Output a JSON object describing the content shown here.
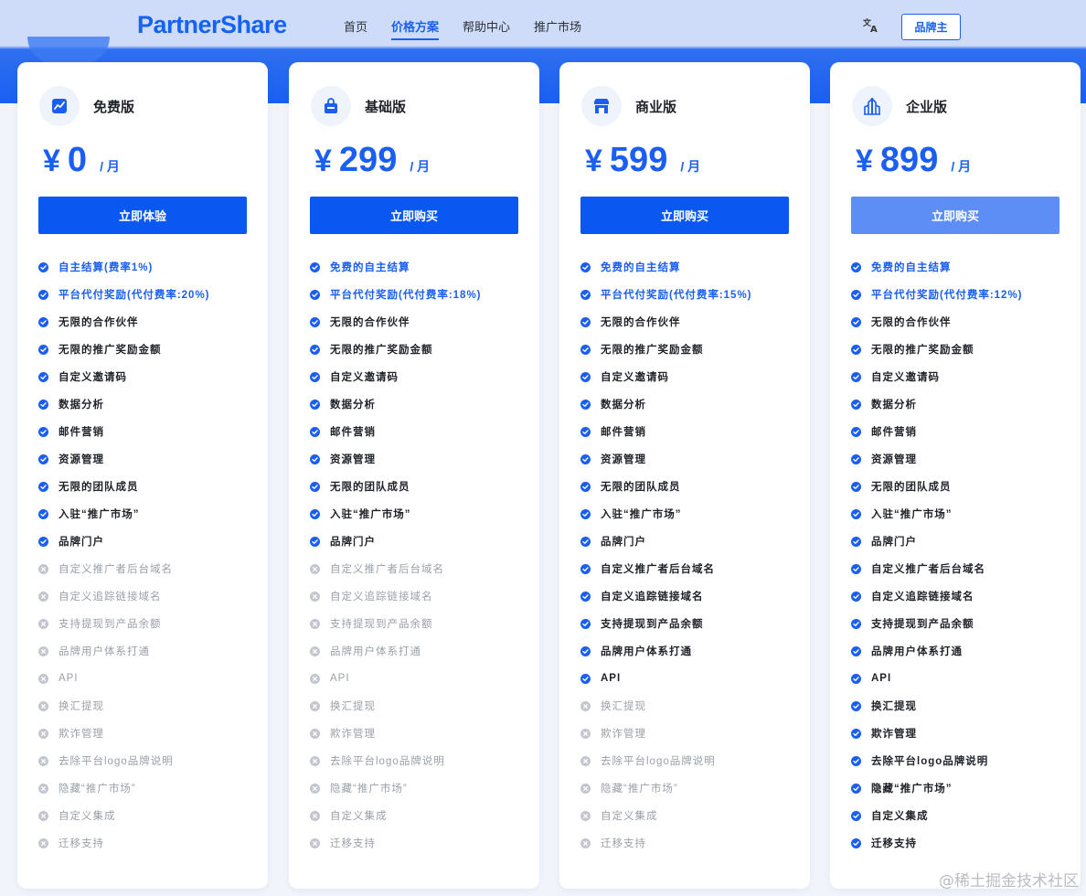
{
  "header": {
    "logo": "PartnerShare",
    "nav": [
      "首页",
      "价格方案",
      "帮助中心",
      "推广市场"
    ],
    "active_nav": "价格方案",
    "lang_icon": "translate-icon",
    "brand_button": "品牌主"
  },
  "colors": {
    "accent": "#1a5ff2",
    "check": "#1a5ff2",
    "cross": "#c3c7cd",
    "disabled_text": "#9aa0a8",
    "header_bg": "#cfdcf9"
  },
  "plans": [
    {
      "name": "免费版",
      "icon": "trend-icon",
      "currency": "¥",
      "price": "0",
      "unit": "/ 月",
      "cta": "立即体验",
      "features": [
        {
          "text": "自主结算(费率1%)",
          "state": "hl"
        },
        {
          "text": "平台代付奖励(代付费率:20%)",
          "state": "hl"
        },
        {
          "text": "无限的合作伙伴",
          "state": "on"
        },
        {
          "text": "无限的推广奖励金额",
          "state": "on"
        },
        {
          "text": "自定义邀请码",
          "state": "on"
        },
        {
          "text": "数据分析",
          "state": "on"
        },
        {
          "text": "邮件营销",
          "state": "on"
        },
        {
          "text": "资源管理",
          "state": "on"
        },
        {
          "text": "无限的团队成员",
          "state": "on"
        },
        {
          "text": "入驻“推广市场”",
          "state": "on"
        },
        {
          "text": "品牌门户",
          "state": "on"
        },
        {
          "text": "自定义推广者后台域名",
          "state": "off"
        },
        {
          "text": "自定义追踪链接域名",
          "state": "off"
        },
        {
          "text": "支持提现到产品余额",
          "state": "off"
        },
        {
          "text": "品牌用户体系打通",
          "state": "off"
        },
        {
          "text": "API",
          "state": "off"
        },
        {
          "text": "换汇提现",
          "state": "off"
        },
        {
          "text": "欺诈管理",
          "state": "off"
        },
        {
          "text": "去除平台logo品牌说明",
          "state": "off"
        },
        {
          "text": "隐藏“推广市场”",
          "state": "off"
        },
        {
          "text": "自定义集成",
          "state": "off"
        },
        {
          "text": "迁移支持",
          "state": "off"
        }
      ]
    },
    {
      "name": "基础版",
      "icon": "shopping-bag-icon",
      "currency": "¥",
      "price": "299",
      "unit": "/ 月",
      "cta": "立即购买",
      "features": [
        {
          "text": "免费的自主结算",
          "state": "hl"
        },
        {
          "text": "平台代付奖励(代付费率:18%)",
          "state": "hl"
        },
        {
          "text": "无限的合作伙伴",
          "state": "on"
        },
        {
          "text": "无限的推广奖励金额",
          "state": "on"
        },
        {
          "text": "自定义邀请码",
          "state": "on"
        },
        {
          "text": "数据分析",
          "state": "on"
        },
        {
          "text": "邮件营销",
          "state": "on"
        },
        {
          "text": "资源管理",
          "state": "on"
        },
        {
          "text": "无限的团队成员",
          "state": "on"
        },
        {
          "text": "入驻“推广市场”",
          "state": "on"
        },
        {
          "text": "品牌门户",
          "state": "on"
        },
        {
          "text": "自定义推广者后台域名",
          "state": "off"
        },
        {
          "text": "自定义追踪链接域名",
          "state": "off"
        },
        {
          "text": "支持提现到产品余额",
          "state": "off"
        },
        {
          "text": "品牌用户体系打通",
          "state": "off"
        },
        {
          "text": "API",
          "state": "off"
        },
        {
          "text": "换汇提现",
          "state": "off"
        },
        {
          "text": "欺诈管理",
          "state": "off"
        },
        {
          "text": "去除平台logo品牌说明",
          "state": "off"
        },
        {
          "text": "隐藏“推广市场”",
          "state": "off"
        },
        {
          "text": "自定义集成",
          "state": "off"
        },
        {
          "text": "迁移支持",
          "state": "off"
        }
      ]
    },
    {
      "name": "商业版",
      "icon": "storefront-icon",
      "currency": "¥",
      "price": "599",
      "unit": "/ 月",
      "cta": "立即购买",
      "features": [
        {
          "text": "免费的自主结算",
          "state": "hl"
        },
        {
          "text": "平台代付奖励(代付费率:15%)",
          "state": "hl"
        },
        {
          "text": "无限的合作伙伴",
          "state": "on"
        },
        {
          "text": "无限的推广奖励金额",
          "state": "on"
        },
        {
          "text": "自定义邀请码",
          "state": "on"
        },
        {
          "text": "数据分析",
          "state": "on"
        },
        {
          "text": "邮件营销",
          "state": "on"
        },
        {
          "text": "资源管理",
          "state": "on"
        },
        {
          "text": "无限的团队成员",
          "state": "on"
        },
        {
          "text": "入驻“推广市场”",
          "state": "on"
        },
        {
          "text": "品牌门户",
          "state": "on"
        },
        {
          "text": "自定义推广者后台域名",
          "state": "on"
        },
        {
          "text": "自定义追踪链接域名",
          "state": "on"
        },
        {
          "text": "支持提现到产品余额",
          "state": "on"
        },
        {
          "text": "品牌用户体系打通",
          "state": "on"
        },
        {
          "text": "API",
          "state": "on"
        },
        {
          "text": "换汇提现",
          "state": "off"
        },
        {
          "text": "欺诈管理",
          "state": "off"
        },
        {
          "text": "去除平台logo品牌说明",
          "state": "off"
        },
        {
          "text": "隐藏“推广市场”",
          "state": "off"
        },
        {
          "text": "自定义集成",
          "state": "off"
        },
        {
          "text": "迁移支持",
          "state": "off"
        }
      ]
    },
    {
      "name": "企业版",
      "icon": "building-icon",
      "currency": "¥",
      "price": "899",
      "unit": "/ 月",
      "cta": "立即购买",
      "features": [
        {
          "text": "免费的自主结算",
          "state": "hl"
        },
        {
          "text": "平台代付奖励(代付费率:12%)",
          "state": "hl"
        },
        {
          "text": "无限的合作伙伴",
          "state": "on"
        },
        {
          "text": "无限的推广奖励金额",
          "state": "on"
        },
        {
          "text": "自定义邀请码",
          "state": "on"
        },
        {
          "text": "数据分析",
          "state": "on"
        },
        {
          "text": "邮件营销",
          "state": "on"
        },
        {
          "text": "资源管理",
          "state": "on"
        },
        {
          "text": "无限的团队成员",
          "state": "on"
        },
        {
          "text": "入驻“推广市场”",
          "state": "on"
        },
        {
          "text": "品牌门户",
          "state": "on"
        },
        {
          "text": "自定义推广者后台域名",
          "state": "on"
        },
        {
          "text": "自定义追踪链接域名",
          "state": "on"
        },
        {
          "text": "支持提现到产品余额",
          "state": "on"
        },
        {
          "text": "品牌用户体系打通",
          "state": "on"
        },
        {
          "text": "API",
          "state": "on"
        },
        {
          "text": "换汇提现",
          "state": "on"
        },
        {
          "text": "欺诈管理",
          "state": "on"
        },
        {
          "text": "去除平台logo品牌说明",
          "state": "on"
        },
        {
          "text": "隐藏“推广市场”",
          "state": "on"
        },
        {
          "text": "自定义集成",
          "state": "on"
        },
        {
          "text": "迁移支持",
          "state": "on"
        }
      ]
    }
  ],
  "watermark": "@稀土掘金技术社区"
}
